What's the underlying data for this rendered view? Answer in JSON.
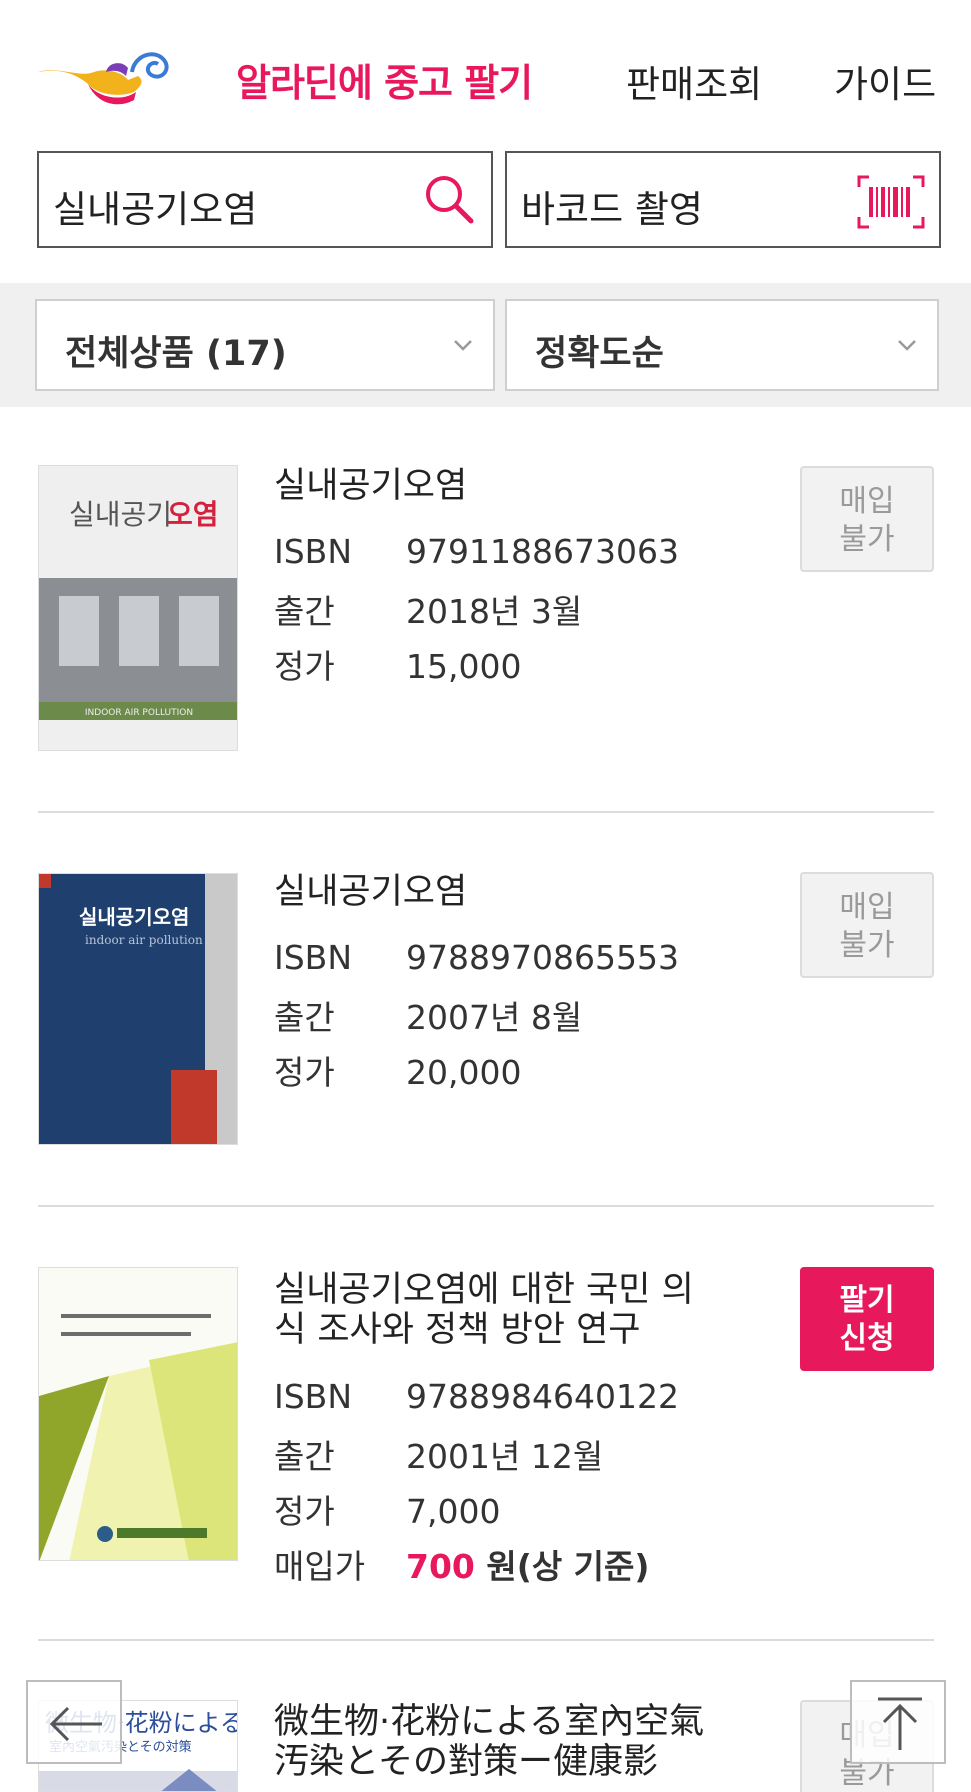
{
  "header": {
    "brand": "알라딘에 중고 팔기",
    "nav": [
      "판매조회",
      "가이드"
    ]
  },
  "search": {
    "query": "실내공기오염",
    "barcode_label": "바코드 촬영"
  },
  "filters": {
    "category": "전체상품 (17)",
    "sort": "정확도순"
  },
  "labels": {
    "isbn": "ISBN",
    "published": "출간",
    "list_price": "정가",
    "buy_price": "매입가"
  },
  "items": [
    {
      "title": "실내공기오염",
      "isbn": "9791188673063",
      "published": "2018년 3월",
      "list_price": "15,000",
      "action": [
        "매입",
        "불가"
      ],
      "cover": {
        "title_a": "실내공기",
        "title_b": "오염",
        "footer": "INDOOR AIR POLLUTION"
      }
    },
    {
      "title": "실내공기오염",
      "isbn": "9788970865553",
      "published": "2007년 8월",
      "list_price": "20,000",
      "action": [
        "매입",
        "불가"
      ],
      "cover": {
        "title": "실내공기오염",
        "subtitle": "indoor air pollution"
      }
    },
    {
      "title": "실내공기오염에 대한 국민 의식 조사와 정책 방안 연구",
      "isbn": "9788984640122",
      "published": "2001년 12월",
      "list_price": "7,000",
      "buy_price": "700",
      "buy_price_suffix": " 원(상 기준)",
      "action": [
        "팔기",
        "신청"
      ]
    },
    {
      "title": "微生物·花粉による室內空氣汚染とその對策ー健康影",
      "action": [
        "매입",
        "불가"
      ],
      "cover": {
        "title": "微生物·花粉による",
        "subtitle": "室內空氣汚染とその対策"
      }
    }
  ],
  "colors": {
    "accent": "#e8185d",
    "disabled_bg": "#f2f2f2",
    "band": "#f0f0f0"
  }
}
